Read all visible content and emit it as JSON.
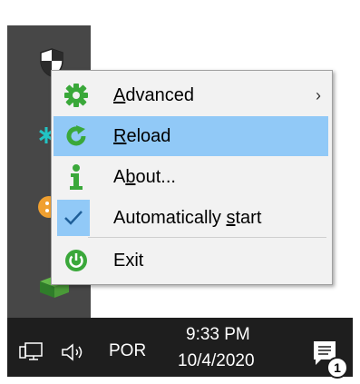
{
  "menu": {
    "items": [
      {
        "pre": "",
        "key": "A",
        "post": "dvanced",
        "icon": "gear-icon",
        "has_submenu": true
      },
      {
        "pre": "",
        "key": "R",
        "post": "eload",
        "icon": "reload-icon",
        "highlighted": true
      },
      {
        "pre": "A",
        "key": "b",
        "post": "out...",
        "icon": "info-icon"
      },
      {
        "pre": "Automatically ",
        "key": "s",
        "post": "tart",
        "icon": "check-icon",
        "checked": true
      },
      {
        "pre": "Exit",
        "key": "",
        "post": "",
        "icon": "power-icon"
      }
    ],
    "submenu_arrow": "›"
  },
  "taskbar": {
    "language": "POR",
    "time": "9:33 PM",
    "date": "10/4/2020",
    "notification_count": "1"
  },
  "colors": {
    "highlight": "#91c9f7",
    "icon_green": "#3aa83a",
    "check_blue": "#1f5f99",
    "tray_column": "#474747",
    "taskbar": "#1e1e1e"
  }
}
